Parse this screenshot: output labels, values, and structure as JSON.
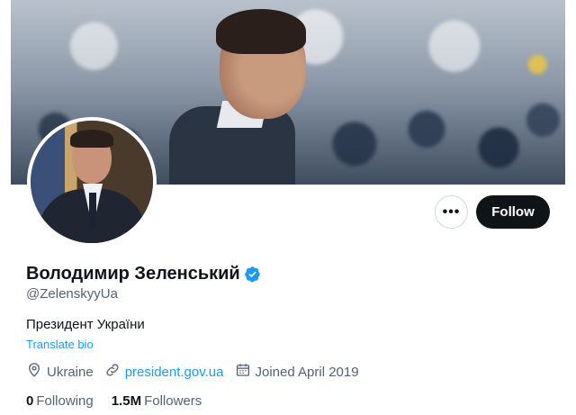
{
  "profile": {
    "name": "Володимир Зеленський",
    "handle": "@ZelenskyyUa",
    "bio": "Президент України",
    "translate_label": "Translate bio",
    "location": "Ukraine",
    "website": "president.gov.ua",
    "joined": "Joined April 2019",
    "verified": true
  },
  "actions": {
    "more_label": "•••",
    "follow_label": "Follow"
  },
  "stats": {
    "following_count": "0",
    "following_label": "Following",
    "followers_count": "1.5M",
    "followers_label": "Followers"
  },
  "icons": {
    "location": "location-pin-icon",
    "link": "link-icon",
    "calendar": "calendar-icon",
    "verified": "verified-badge-icon"
  },
  "colors": {
    "accent": "#1d9bf0",
    "text_primary": "#0f1419",
    "text_secondary": "#536471",
    "follow_bg": "#0f1419"
  }
}
